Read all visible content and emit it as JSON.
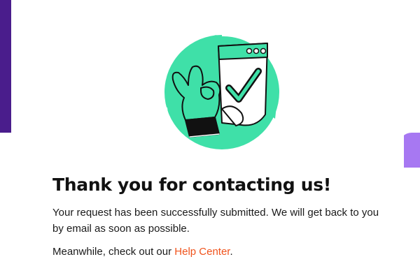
{
  "confirmation": {
    "title": "Thank you for contacting us!",
    "message": "Your request has been successfully submitted. We will get back to you by email as soon as possible.",
    "help_prefix": "Meanwhile, check out our ",
    "help_link": "Help Center",
    "help_suffix": "."
  },
  "colors": {
    "accent_green": "#3fe0a8",
    "link_orange": "#f0531c",
    "purple": "#4a1d8c",
    "lavender": "#a778f2"
  },
  "illustration": {
    "icon": "ok-hand-checkmark-document-icon"
  }
}
